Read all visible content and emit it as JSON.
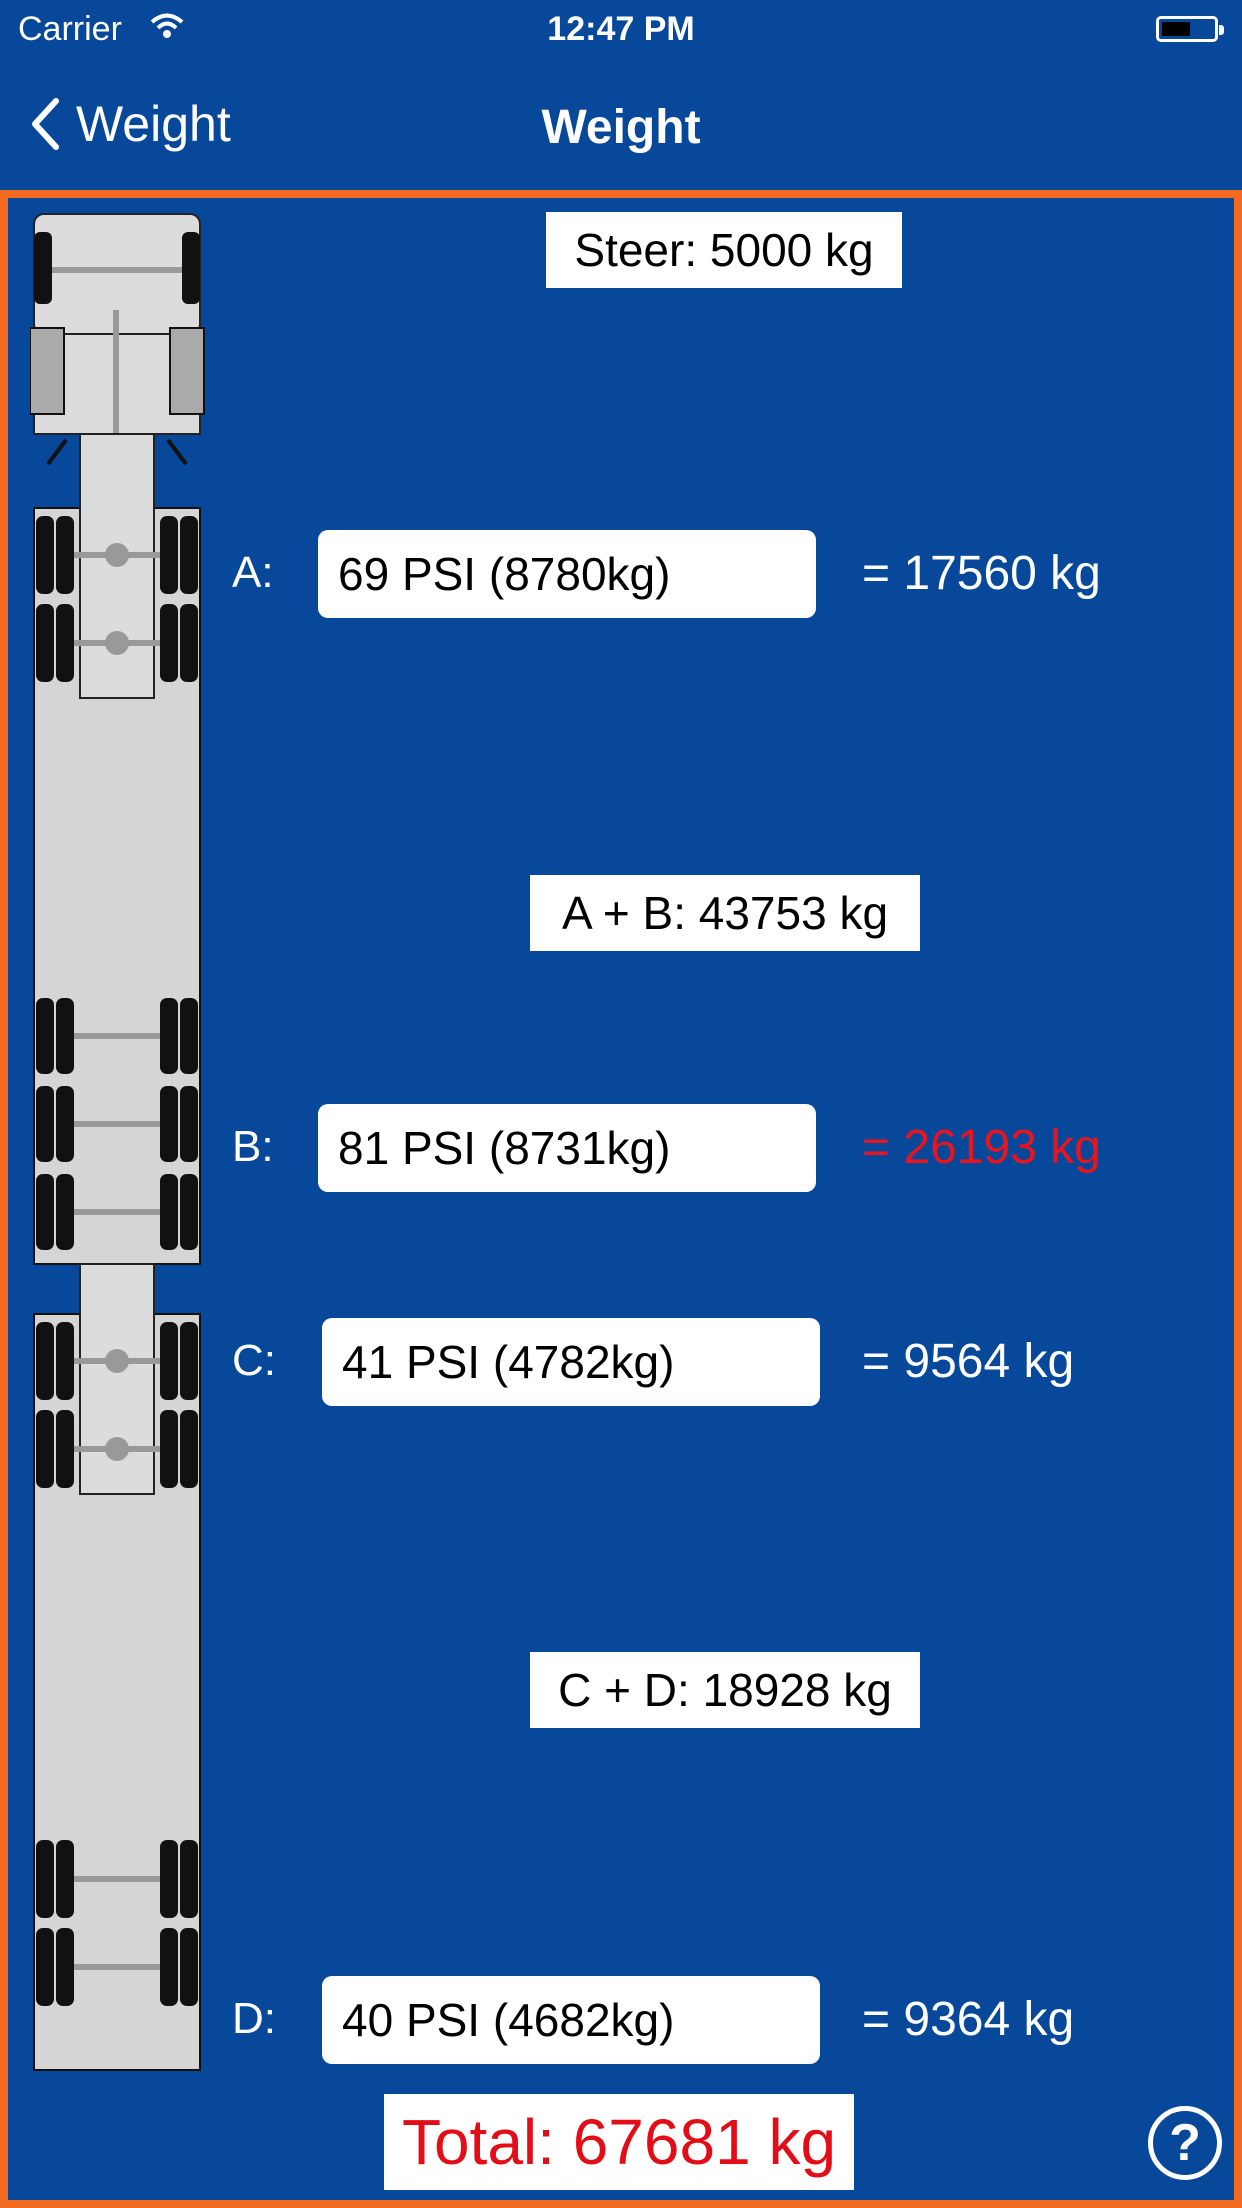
{
  "status_bar": {
    "carrier": "Carrier",
    "time": "12:47 PM"
  },
  "nav": {
    "back_label": "Weight",
    "title": "Weight"
  },
  "steer": {
    "label": "Steer: 5000 kg"
  },
  "group_ab": {
    "label": "A + B: 43753 kg"
  },
  "group_cd": {
    "label": "C + D: 18928 kg"
  },
  "axles": [
    {
      "letter": "A:",
      "value": "69 PSI (8780kg)",
      "result": "= 17560 kg",
      "over_limit": false
    },
    {
      "letter": "B:",
      "value": "81 PSI (8731kg)",
      "result": "= 26193 kg",
      "over_limit": true
    },
    {
      "letter": "C:",
      "value": "41 PSI (4782kg)",
      "result": "= 9564 kg",
      "over_limit": false
    },
    {
      "letter": "D:",
      "value": "40 PSI (4682kg)",
      "result": "= 9364 kg",
      "over_limit": false
    }
  ],
  "total": {
    "label": "Total: 67681 kg"
  },
  "help": {
    "symbol": "?"
  },
  "colors": {
    "background": "#08489a",
    "border": "#f26b21",
    "alert_red": "#e30d17"
  }
}
